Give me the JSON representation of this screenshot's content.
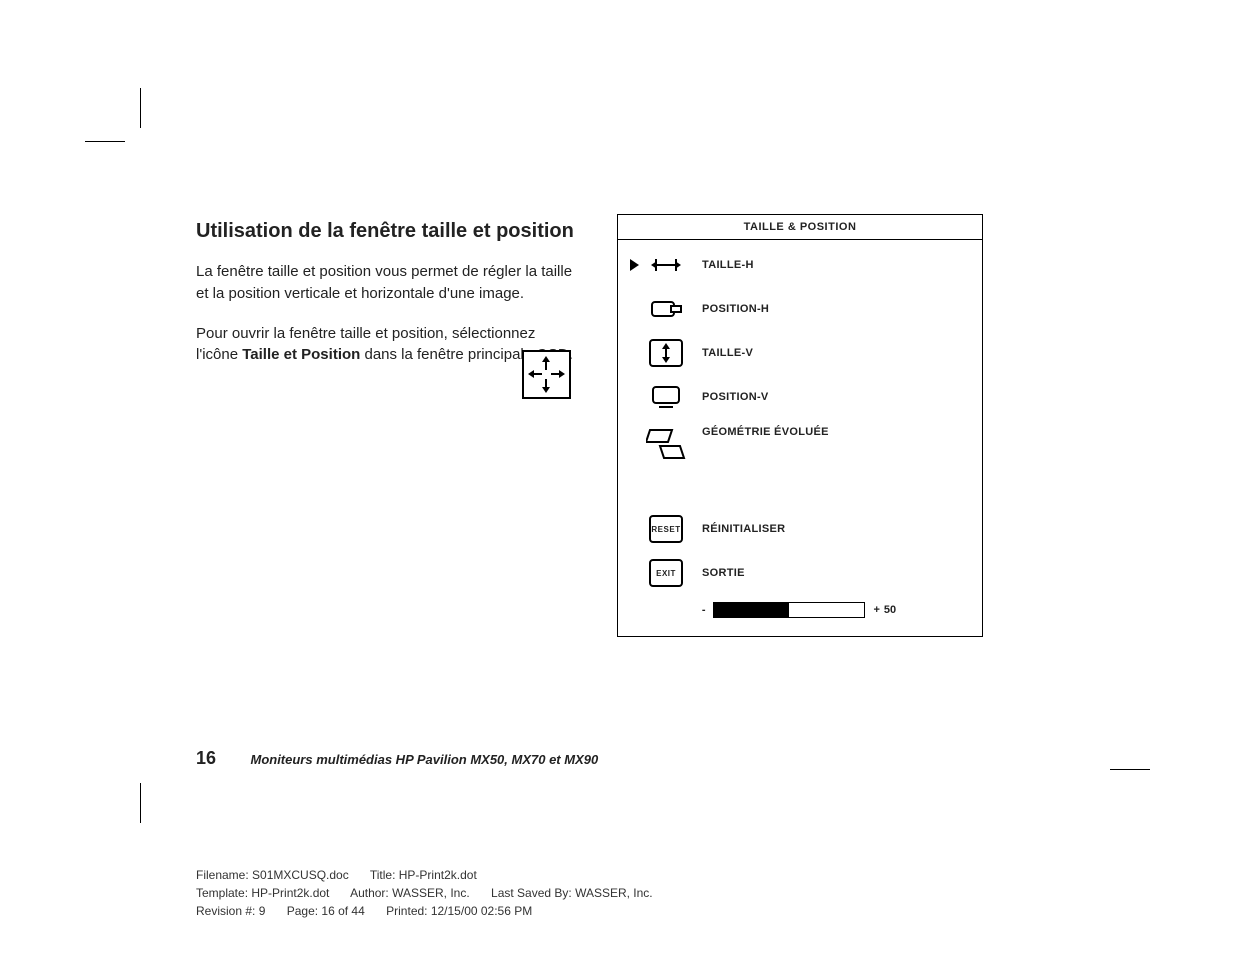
{
  "article": {
    "heading": "Utilisation de la fenêtre taille et position",
    "para1": "La fenêtre taille et position vous permet de régler la taille et la position verticale et horizontale d'une image.",
    "para2_a": "Pour ouvrir la fenêtre taille et position, sélectionnez l'icône ",
    "para2_bold": "Taille et Position",
    "para2_b": " dans la fenêtre principale OSD."
  },
  "osd": {
    "title": "TAILLE & POSITION",
    "items": [
      {
        "label": "TAILLE-H",
        "icon": "hsize",
        "selected": true
      },
      {
        "label": "POSITION-H",
        "icon": "hpos",
        "selected": false
      },
      {
        "label": "TAILLE-V",
        "icon": "vsize",
        "selected": false
      },
      {
        "label": "POSITION-V",
        "icon": "vpos",
        "selected": false
      },
      {
        "label": "GÉOMÉTRIE ÉVOLUÉE",
        "icon": "geom",
        "selected": false
      }
    ],
    "reset": {
      "label": "RÉINITIALISER",
      "btn": "RESET"
    },
    "exit": {
      "label": "SORTIE",
      "btn": "EXIT"
    },
    "slider": {
      "minus": "-",
      "plus": "+",
      "value": "50",
      "fill_pct": 50
    }
  },
  "footer": {
    "page": "16",
    "title": "Moniteurs multimédias HP Pavilion MX50, MX70 et MX90"
  },
  "meta": {
    "filename": "Filename: S01MXCUSQ.doc",
    "title": "Title: HP-Print2k.dot",
    "template": "Template: HP-Print2k.dot",
    "author": "Author: WASSER, Inc.",
    "saved": "Last Saved By: WASSER, Inc.",
    "rev": "Revision #: 9",
    "page": "Page: 16 of 44",
    "printed": "Printed: 12/15/00 02:56 PM"
  }
}
